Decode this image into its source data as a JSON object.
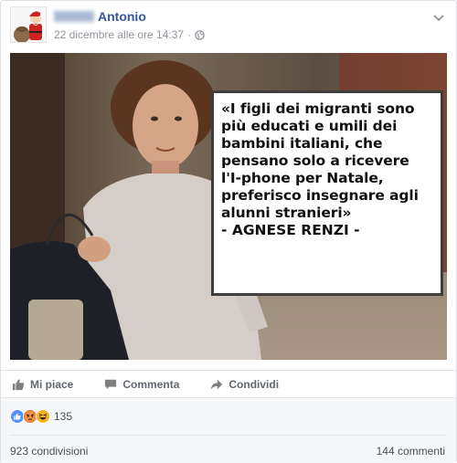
{
  "post": {
    "author_name": "Antonio",
    "timestamp": "22 dicembre alle ore 14:37",
    "separator": "·",
    "privacy_icon": "globe-icon",
    "options_icon": "chevron-down-icon"
  },
  "image": {
    "quote": "«I figli dei migranti sono\npiù educati e umili dei\nbambini italiani, che\npensano solo a ricevere\nl'I-phone per Natale,\npreferisco insegnare agli\nalunni stranieri»",
    "attribution": "- AGNESE RENZI -"
  },
  "actions": {
    "like": "Mi piace",
    "comment": "Commenta",
    "share": "Condividi"
  },
  "reactions": {
    "icons": [
      "like-icon",
      "angry-icon",
      "haha-icon"
    ],
    "count": "135"
  },
  "footer": {
    "shares": "923 condivisioni",
    "comments": "144 commenti"
  },
  "colors": {
    "link": "#365899",
    "like": "#5890ff",
    "angry": "#e9710f",
    "haha": "#f7b125"
  }
}
